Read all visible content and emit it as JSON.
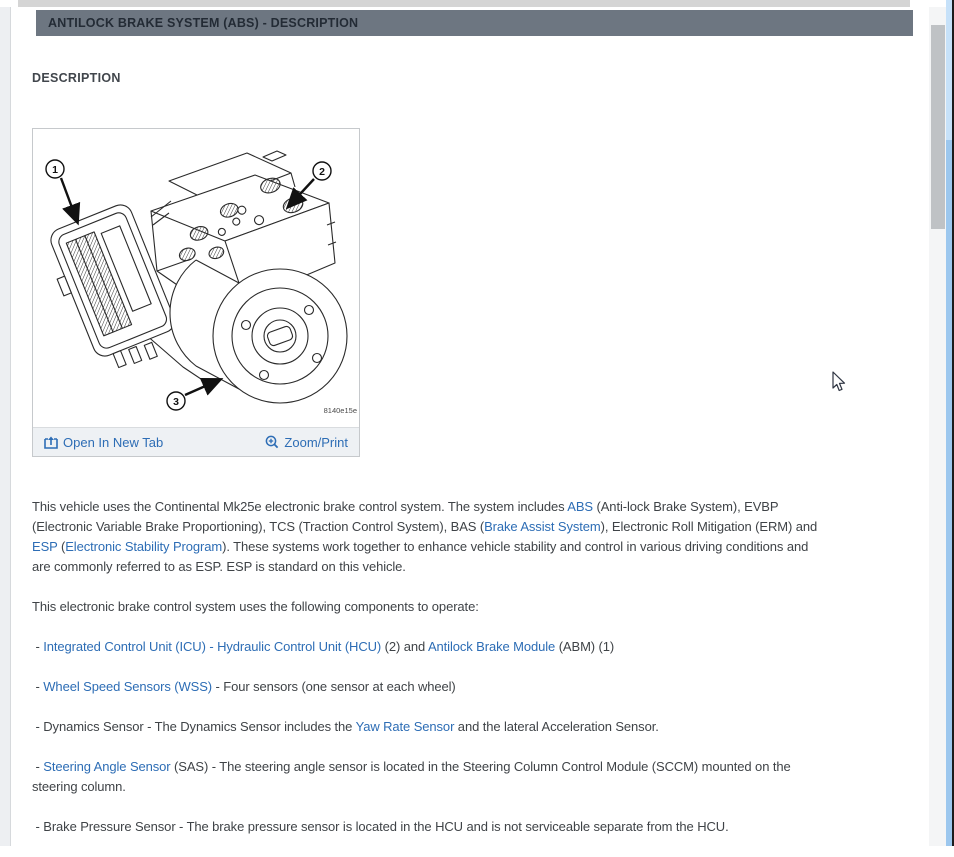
{
  "page": {
    "header": {
      "title": "ANTILOCK BRAKE SYSTEM (ABS) - DESCRIPTION"
    },
    "section_heading": "DESCRIPTION",
    "figure": {
      "code": "8140e15e",
      "callouts": [
        "1",
        "2",
        "3"
      ],
      "open_label": "Open In New Tab",
      "zoom_label": "Zoom/Print"
    },
    "colors": {
      "accent_blue": "#2d6db5",
      "header_bar_bg": "#6d7681",
      "header_text": "#232b35",
      "body_text": "#3f4347",
      "inner_scroll_thumb": "#bfc2c5",
      "outer_scroll_thumb": "#9cc7ee"
    },
    "content": {
      "blocks": [
        {
          "lines": [
            [
              {
                "t": "This vehicle uses the Continental Mk25e electronic brake control system. The system includes "
              },
              {
                "t": "ABS",
                "link": true
              },
              {
                "t": " (Anti-lock Brake System), EVBP"
              }
            ],
            [
              {
                "t": "(Electronic Variable Brake Proportioning), TCS (Traction Control System), BAS ("
              },
              {
                "t": "Brake Assist System",
                "link": true
              },
              {
                "t": "), Electronic Roll Mitigation (ERM) and"
              }
            ],
            [
              {
                "t": "ESP",
                "link": true
              },
              {
                "t": " ("
              },
              {
                "t": "Electronic Stability Program",
                "link": true
              },
              {
                "t": "). These systems work together to enhance vehicle stability and control in various driving conditions and"
              }
            ],
            [
              {
                "t": "are commonly referred to as ESP. ESP is standard on this vehicle."
              }
            ]
          ]
        },
        {
          "lines": [
            [
              {
                "t": "This electronic brake control system uses the following components to operate:"
              }
            ]
          ]
        },
        {
          "lines": [
            [
              {
                "t": " - "
              },
              {
                "t": "Integrated Control Unit (ICU) - Hydraulic Control Unit (HCU)",
                "link": true
              },
              {
                "t": " (2) and "
              },
              {
                "t": "Antilock Brake Module",
                "link": true
              },
              {
                "t": " (ABM) (1)"
              }
            ]
          ]
        },
        {
          "lines": [
            [
              {
                "t": " - "
              },
              {
                "t": "Wheel Speed Sensors (WSS)",
                "link": true
              },
              {
                "t": " - Four sensors (one sensor at each wheel)"
              }
            ]
          ]
        },
        {
          "lines": [
            [
              {
                "t": " - Dynamics Sensor - The Dynamics Sensor includes the "
              },
              {
                "t": "Yaw Rate Sensor",
                "link": true
              },
              {
                "t": " and the lateral Acceleration Sensor."
              }
            ]
          ]
        },
        {
          "lines": [
            [
              {
                "t": " - "
              },
              {
                "t": "Steering Angle Sensor",
                "link": true
              },
              {
                "t": " (SAS) - The steering angle sensor is located in the Steering Column Control Module (SCCM) mounted on the"
              }
            ],
            [
              {
                "t": "steering column."
              }
            ]
          ]
        },
        {
          "lines": [
            [
              {
                "t": " - Brake Pressure Sensor - The brake pressure sensor is located in the HCU and is not serviceable separate from the HCU."
              }
            ]
          ]
        }
      ]
    }
  }
}
